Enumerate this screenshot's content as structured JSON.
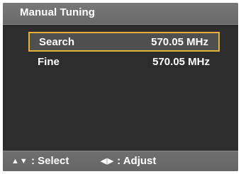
{
  "title": "Manual Tuning",
  "rows": [
    {
      "label": "Search",
      "value": "570.05 MHz",
      "selected": true
    },
    {
      "label": "Fine",
      "value": "570.05 MHz",
      "selected": false
    }
  ],
  "help": {
    "select_icons": [
      "up-arrow-icon",
      "down-arrow-icon"
    ],
    "select_text": ": Select",
    "adjust_icons": [
      "left-arrow-icon",
      "right-arrow-icon"
    ],
    "adjust_text": ": Adjust"
  },
  "colors": {
    "background": "#2d2d2d",
    "bar": "#6f6f6f",
    "highlight_border": "#e5b13a",
    "text": "#ffffff"
  }
}
